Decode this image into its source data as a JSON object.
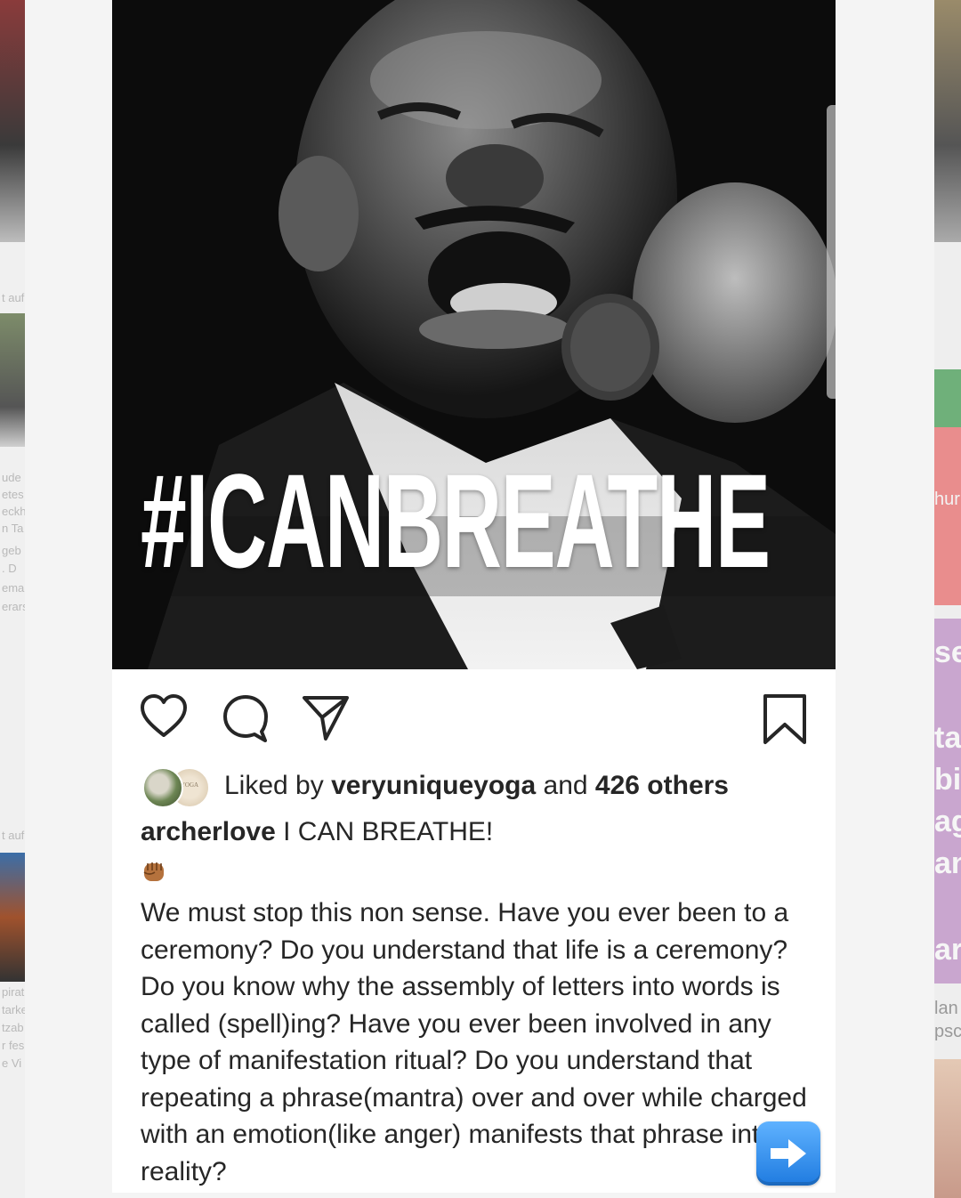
{
  "post": {
    "image_overlay_text": "#ICANBREATHE",
    "likes": {
      "prefix": "Liked by",
      "user": "veryuniqueyoga",
      "connector": "and",
      "others": "426 others"
    },
    "caption": {
      "username": "archerlove",
      "headline": "I CAN BREATHE!",
      "emoji_icon": "raised-fist-icon",
      "body": "We must stop this non sense. Have you ever been to a ceremony? Do you understand that life is a ceremony? Do you know why the assembly of letters into words is called (spell)ing? Have you ever been involved in any type of manifestation ritual? Do you understand that repeating a phrase(mantra) over and over while charged with an emotion(like anger) manifests that phrase into reality?"
    },
    "actions": [
      "heart-icon",
      "comment-icon",
      "share-icon",
      "bookmark-icon"
    ],
    "next_icon": "right-arrow-icon"
  },
  "background": {
    "left_fragments": [
      "t auf",
      "ude",
      "etes",
      "eckh",
      "n Ta",
      "geb",
      ". D",
      "ema",
      "erars",
      "t auf",
      "pirat",
      "tarke",
      "tzab",
      "r fes",
      "e Vi"
    ],
    "right_fragments": [
      "hur",
      "se",
      "ta",
      "bi",
      "ag",
      "an",
      "ar",
      "lan",
      "psc"
    ]
  },
  "colors": {
    "text": "#262626",
    "card": "#ffffff",
    "photo_bg": "#0c0c0c",
    "arrow_button": "#2b8cf0"
  }
}
